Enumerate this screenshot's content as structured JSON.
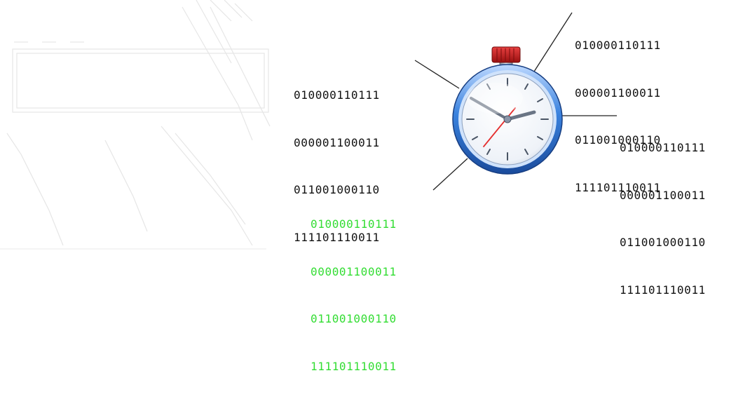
{
  "colors": {
    "default_text": "#111111",
    "highlight_text": "#33dd33",
    "connector_line": "#222222",
    "clock_rim": "#2d6fcc",
    "clock_face": "#f7f9fc",
    "crown": "#cc1f1f",
    "second_hand": "#e53030",
    "hour_minute_hands": "#6a7585"
  },
  "icons": {
    "clock": "stopwatch-clock-icon"
  },
  "blocks": [
    {
      "id": "top-right",
      "highlighted": false,
      "lines": [
        "010000110111",
        "000001100011",
        "011001000110",
        "111101110011"
      ]
    },
    {
      "id": "upper-left",
      "highlighted": false,
      "lines": [
        "010000110111",
        "000001100011",
        "011001000110",
        "111101110011"
      ]
    },
    {
      "id": "right",
      "highlighted": false,
      "lines": [
        "010000110111",
        "000001100011",
        "011001000110",
        "111101110011"
      ]
    },
    {
      "id": "lower-left",
      "highlighted": true,
      "lines": [
        "010000110111",
        "000001100011",
        "011001000110",
        "111101110011"
      ]
    }
  ]
}
